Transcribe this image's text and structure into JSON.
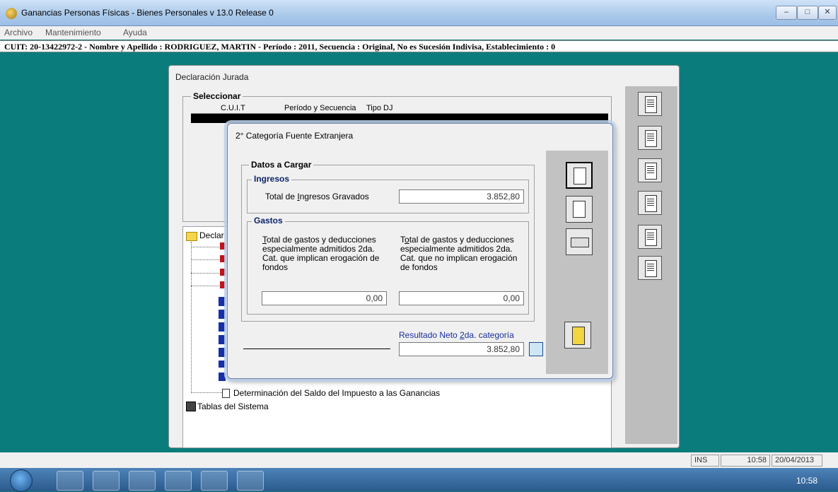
{
  "window": {
    "title": "Ganancias Personas Físicas - Bienes Personales v 13.0 Release 0",
    "minimize_label": "–",
    "maximize_label": "□",
    "close_label": "✕"
  },
  "menu": [
    "Archivo",
    "Mantenimiento",
    "Ayuda"
  ],
  "infobar": "CUIT: 20-13422972-2 - Nombre y Apellido : RODRIGUEZ, MARTIN - Período : 2011, Secuencia : Original, No es Sucesión Indivisa, Establecimiento : 0",
  "main_window": {
    "title": "Declaración Jurada",
    "select_label": "Seleccionar",
    "columns": [
      "C.U.I.T",
      "Período y Secuencia",
      "Tipo DJ"
    ],
    "tree_items": {
      "root": "Declar",
      "determinacion": "Determinación del Saldo del Impuesto a las Ganancias",
      "tablas": "Tablas del Sistema"
    }
  },
  "dialog": {
    "title": "2° Categoría Fuente Extranjera",
    "datos_label": "Datos a Cargar",
    "ingresos_label": "Ingresos",
    "total_ingresos_pre": "Total de ",
    "total_ingresos_u": "I",
    "total_ingresos_post": "ngresos Gravados",
    "total_ingresos_value": "3.852,80",
    "gastos_label": "Gastos",
    "gasto1_u": "T",
    "gasto1_rest": "otal de gastos y deducciones",
    "gasto1_l2": "especialmente admitidos 2da.",
    "gasto1_l3": "Cat. que implican erogación de",
    "gasto1_l4": "fondos",
    "gasto1_value": "0,00",
    "gasto2_pre": "T",
    "gasto2_u": "o",
    "gasto2_rest": "tal de gastos y deducciones",
    "gasto2_l2": "especialmente admitidos 2da.",
    "gasto2_l3": "Cat. que no implican erogación",
    "gasto2_l4": "de fondos",
    "gasto2_value": "0,00",
    "resultado_pre": "Resultado Neto ",
    "resultado_u": "2",
    "resultado_post": "da. categoría",
    "resultado_value": "3.852,80"
  },
  "status": {
    "ins": "INS",
    "time": "10:58",
    "date": "20/04/2013"
  },
  "taskbar": {
    "clock": "10:58"
  }
}
